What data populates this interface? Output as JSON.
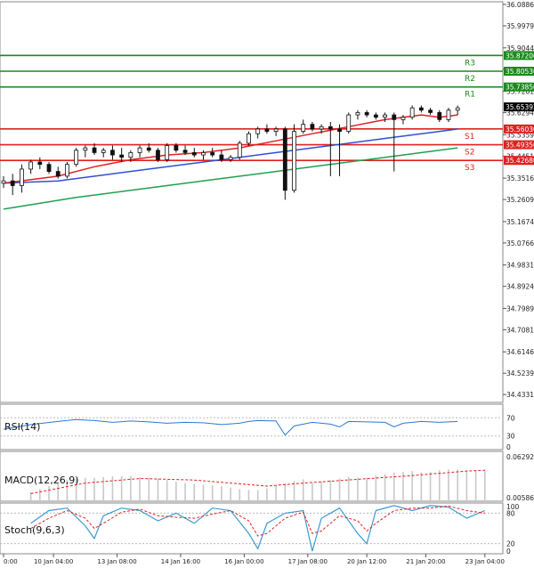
{
  "chart_data": {
    "type": "candlestick",
    "instrument": "",
    "main": {
      "ylim": [
        34.4,
        36.1
      ],
      "y_ticks": [
        "36.08865",
        "35.99790",
        "35.90440",
        "35.81365",
        "35.72015",
        "35.62940",
        "35.53590",
        "35.44515",
        "35.35165",
        "35.26090",
        "35.16740",
        "35.07665",
        "34.98315",
        "34.89240",
        "34.79890",
        "34.70815",
        "34.61465",
        "34.52390",
        "34.43315"
      ],
      "current_price": "35.65392",
      "levels": [
        {
          "label": "R3",
          "value": 35.872,
          "value_text": "35.87200",
          "color": "#1a8a1a"
        },
        {
          "label": "R2",
          "value": 35.8053,
          "value_text": "35.80530",
          "color": "#1a8a1a"
        },
        {
          "label": "R1",
          "value": 35.7385,
          "value_text": "35.73850",
          "color": "#1a8a1a"
        },
        {
          "label": "S1",
          "value": 35.5603,
          "value_text": "35.56030",
          "color": "#e02020"
        },
        {
          "label": "S2",
          "value": 35.4935,
          "value_text": "35.49350",
          "color": "#e02020"
        },
        {
          "label": "S3",
          "value": 35.4268,
          "value_text": "35.42680",
          "color": "#e02020"
        }
      ],
      "candles": [
        {
          "t": 0,
          "o": 35.33,
          "h": 35.36,
          "l": 35.31,
          "c": 35.34
        },
        {
          "t": 1,
          "o": 35.34,
          "h": 35.37,
          "l": 35.28,
          "c": 35.32
        },
        {
          "t": 2,
          "o": 35.32,
          "h": 35.41,
          "l": 35.29,
          "c": 35.39
        },
        {
          "t": 3,
          "o": 35.39,
          "h": 35.43,
          "l": 35.37,
          "c": 35.42
        },
        {
          "t": 4,
          "o": 35.42,
          "h": 35.44,
          "l": 35.39,
          "c": 35.41
        },
        {
          "t": 5,
          "o": 35.41,
          "h": 35.42,
          "l": 35.37,
          "c": 35.38
        },
        {
          "t": 6,
          "o": 35.38,
          "h": 35.4,
          "l": 35.35,
          "c": 35.36
        },
        {
          "t": 7,
          "o": 35.36,
          "h": 35.42,
          "l": 35.35,
          "c": 35.41
        },
        {
          "t": 8,
          "o": 35.41,
          "h": 35.48,
          "l": 35.4,
          "c": 35.47
        },
        {
          "t": 9,
          "o": 35.47,
          "h": 35.49,
          "l": 35.44,
          "c": 35.48
        },
        {
          "t": 10,
          "o": 35.48,
          "h": 35.5,
          "l": 35.45,
          "c": 35.46
        },
        {
          "t": 11,
          "o": 35.46,
          "h": 35.48,
          "l": 35.44,
          "c": 35.47
        },
        {
          "t": 12,
          "o": 35.47,
          "h": 35.49,
          "l": 35.43,
          "c": 35.45
        },
        {
          "t": 13,
          "o": 35.45,
          "h": 35.48,
          "l": 35.42,
          "c": 35.44
        },
        {
          "t": 14,
          "o": 35.44,
          "h": 35.47,
          "l": 35.42,
          "c": 35.46
        },
        {
          "t": 15,
          "o": 35.46,
          "h": 35.49,
          "l": 35.44,
          "c": 35.48
        },
        {
          "t": 16,
          "o": 35.48,
          "h": 35.5,
          "l": 35.46,
          "c": 35.47
        },
        {
          "t": 17,
          "o": 35.47,
          "h": 35.48,
          "l": 35.42,
          "c": 35.43
        },
        {
          "t": 18,
          "o": 35.43,
          "h": 35.5,
          "l": 35.42,
          "c": 35.49
        },
        {
          "t": 19,
          "o": 35.49,
          "h": 35.5,
          "l": 35.46,
          "c": 35.47
        },
        {
          "t": 20,
          "o": 35.47,
          "h": 35.49,
          "l": 35.45,
          "c": 35.46
        },
        {
          "t": 21,
          "o": 35.46,
          "h": 35.48,
          "l": 35.44,
          "c": 35.45
        },
        {
          "t": 22,
          "o": 35.45,
          "h": 35.47,
          "l": 35.43,
          "c": 35.46
        },
        {
          "t": 23,
          "o": 35.46,
          "h": 35.48,
          "l": 35.44,
          "c": 35.45
        },
        {
          "t": 24,
          "o": 35.45,
          "h": 35.47,
          "l": 35.42,
          "c": 35.43
        },
        {
          "t": 25,
          "o": 35.43,
          "h": 35.45,
          "l": 35.42,
          "c": 35.44
        },
        {
          "t": 26,
          "o": 35.44,
          "h": 35.51,
          "l": 35.43,
          "c": 35.5
        },
        {
          "t": 27,
          "o": 35.5,
          "h": 35.55,
          "l": 35.49,
          "c": 35.54
        },
        {
          "t": 28,
          "o": 35.54,
          "h": 35.57,
          "l": 35.52,
          "c": 35.56
        },
        {
          "t": 29,
          "o": 35.56,
          "h": 35.58,
          "l": 35.54,
          "c": 35.55
        },
        {
          "t": 30,
          "o": 35.55,
          "h": 35.57,
          "l": 35.53,
          "c": 35.56
        },
        {
          "t": 31,
          "o": 35.56,
          "h": 35.57,
          "l": 35.26,
          "c": 35.3
        },
        {
          "t": 32,
          "o": 35.3,
          "h": 35.58,
          "l": 35.29,
          "c": 35.55
        },
        {
          "t": 33,
          "o": 35.55,
          "h": 35.6,
          "l": 35.54,
          "c": 35.58
        },
        {
          "t": 34,
          "o": 35.58,
          "h": 35.59,
          "l": 35.55,
          "c": 35.56
        },
        {
          "t": 35,
          "o": 35.56,
          "h": 35.58,
          "l": 35.54,
          "c": 35.57
        },
        {
          "t": 36,
          "o": 35.57,
          "h": 35.59,
          "l": 35.36,
          "c": 35.56
        },
        {
          "t": 37,
          "o": 35.56,
          "h": 35.58,
          "l": 35.36,
          "c": 35.55
        },
        {
          "t": 38,
          "o": 35.55,
          "h": 35.63,
          "l": 35.54,
          "c": 35.62
        },
        {
          "t": 39,
          "o": 35.62,
          "h": 35.64,
          "l": 35.6,
          "c": 35.63
        },
        {
          "t": 40,
          "o": 35.63,
          "h": 35.64,
          "l": 35.61,
          "c": 35.62
        },
        {
          "t": 41,
          "o": 35.62,
          "h": 35.63,
          "l": 35.6,
          "c": 35.61
        },
        {
          "t": 42,
          "o": 35.61,
          "h": 35.63,
          "l": 35.59,
          "c": 35.62
        },
        {
          "t": 43,
          "o": 35.62,
          "h": 35.63,
          "l": 35.38,
          "c": 35.6
        },
        {
          "t": 44,
          "o": 35.6,
          "h": 35.62,
          "l": 35.58,
          "c": 35.61
        },
        {
          "t": 45,
          "o": 35.61,
          "h": 35.66,
          "l": 35.6,
          "c": 35.65
        },
        {
          "t": 46,
          "o": 35.65,
          "h": 35.66,
          "l": 35.63,
          "c": 35.64
        },
        {
          "t": 47,
          "o": 35.64,
          "h": 35.65,
          "l": 35.62,
          "c": 35.63
        },
        {
          "t": 48,
          "o": 35.63,
          "h": 35.64,
          "l": 35.59,
          "c": 35.6
        },
        {
          "t": 49,
          "o": 35.6,
          "h": 35.65,
          "l": 35.59,
          "c": 35.64
        },
        {
          "t": 50,
          "o": 35.64,
          "h": 35.66,
          "l": 35.62,
          "c": 35.65
        }
      ],
      "ma_fast": {
        "color": "#e02020",
        "values": [
          [
            0,
            35.33
          ],
          [
            6,
            35.36
          ],
          [
            10,
            35.4
          ],
          [
            14,
            35.43
          ],
          [
            18,
            35.45
          ],
          [
            22,
            35.46
          ],
          [
            26,
            35.48
          ],
          [
            30,
            35.51
          ],
          [
            34,
            35.54
          ],
          [
            38,
            35.57
          ],
          [
            42,
            35.6
          ],
          [
            46,
            35.62
          ],
          [
            48,
            35.61
          ],
          [
            50,
            35.62
          ]
        ]
      },
      "ma_mid": {
        "color": "#3050d0",
        "values": [
          [
            0,
            35.33
          ],
          [
            6,
            35.34
          ],
          [
            12,
            35.37
          ],
          [
            18,
            35.4
          ],
          [
            24,
            35.43
          ],
          [
            30,
            35.46
          ],
          [
            36,
            35.49
          ],
          [
            42,
            35.52
          ],
          [
            48,
            35.55
          ],
          [
            50,
            35.56
          ]
        ]
      },
      "ma_slow": {
        "color": "#20a050",
        "values": [
          [
            0,
            35.22
          ],
          [
            8,
            35.27
          ],
          [
            16,
            35.31
          ],
          [
            24,
            35.35
          ],
          [
            30,
            35.38
          ],
          [
            36,
            35.41
          ],
          [
            42,
            35.44
          ],
          [
            48,
            35.47
          ],
          [
            50,
            35.48
          ]
        ]
      }
    },
    "x_labels": [
      {
        "pos": 0,
        "text": "0:00"
      },
      {
        "pos": 5.5,
        "text": "10 Jan 04:00"
      },
      {
        "pos": 12.5,
        "text": "13 Jan 08:00"
      },
      {
        "pos": 19.5,
        "text": "14 Jan 16:00"
      },
      {
        "pos": 26.5,
        "text": "16 Jan 00:00"
      },
      {
        "pos": 33.5,
        "text": "17 Jan 08:00"
      },
      {
        "pos": 40,
        "text": "20 Jan 12:00"
      },
      {
        "pos": 46.5,
        "text": "21 Jan 20:00"
      },
      {
        "pos": 53,
        "text": "23 Jan 04:00"
      }
    ],
    "rsi": {
      "label": "RSI(14)",
      "ylim": [
        0,
        100
      ],
      "ticks": [
        "70",
        "30",
        "0"
      ],
      "levels": [
        70,
        30
      ],
      "color": "#2a78d8",
      "values": [
        [
          0,
          45
        ],
        [
          3,
          55
        ],
        [
          6,
          62
        ],
        [
          8,
          66
        ],
        [
          10,
          64
        ],
        [
          12,
          60
        ],
        [
          14,
          63
        ],
        [
          16,
          61
        ],
        [
          18,
          58
        ],
        [
          20,
          60
        ],
        [
          22,
          59
        ],
        [
          24,
          55
        ],
        [
          26,
          58
        ],
        [
          27,
          62
        ],
        [
          28,
          64
        ],
        [
          30,
          63
        ],
        [
          31,
          32
        ],
        [
          32,
          52
        ],
        [
          34,
          60
        ],
        [
          36,
          56
        ],
        [
          37,
          50
        ],
        [
          38,
          62
        ],
        [
          40,
          61
        ],
        [
          42,
          60
        ],
        [
          43,
          50
        ],
        [
          44,
          58
        ],
        [
          46,
          62
        ],
        [
          48,
          60
        ],
        [
          50,
          62
        ]
      ]
    },
    "macd": {
      "label": "MACD(12,26,9)",
      "ticks": [
        "0.062928",
        "0.005862"
      ],
      "hist_color": "#c8c8c8",
      "signal_color": "#e02020",
      "hist": [
        0.012,
        0.016,
        0.02,
        0.024,
        0.028,
        0.03,
        0.031,
        0.031,
        0.032,
        0.033,
        0.033,
        0.033,
        0.032,
        0.031,
        0.03,
        0.028,
        0.026,
        0.024,
        0.023,
        0.022,
        0.021,
        0.02,
        0.018,
        0.016,
        0.015,
        0.015,
        0.017,
        0.02,
        0.024,
        0.027,
        0.029,
        0.024,
        0.026,
        0.028,
        0.03,
        0.032,
        0.031,
        0.031,
        0.034,
        0.036,
        0.038,
        0.039,
        0.04,
        0.038,
        0.039,
        0.041,
        0.042,
        0.042,
        0.041,
        0.041,
        0.042
      ],
      "signal": [
        [
          0,
          0.01
        ],
        [
          6,
          0.024
        ],
        [
          12,
          0.03
        ],
        [
          18,
          0.028
        ],
        [
          22,
          0.024
        ],
        [
          26,
          0.02
        ],
        [
          30,
          0.024
        ],
        [
          36,
          0.029
        ],
        [
          42,
          0.034
        ],
        [
          48,
          0.04
        ],
        [
          50,
          0.041
        ]
      ]
    },
    "stoch": {
      "label": "Stoch(9,6,3)",
      "ticks": [
        "100",
        "80",
        "20",
        "0"
      ],
      "levels": [
        80,
        20
      ],
      "k_color": "#3a9ad0",
      "d_color": "#e02020",
      "k": [
        [
          0,
          60
        ],
        [
          2,
          85
        ],
        [
          4,
          90
        ],
        [
          6,
          55
        ],
        [
          7,
          30
        ],
        [
          8,
          75
        ],
        [
          10,
          90
        ],
        [
          12,
          85
        ],
        [
          14,
          65
        ],
        [
          16,
          80
        ],
        [
          18,
          60
        ],
        [
          20,
          90
        ],
        [
          22,
          85
        ],
        [
          24,
          40
        ],
        [
          25,
          10
        ],
        [
          26,
          60
        ],
        [
          28,
          80
        ],
        [
          30,
          85
        ],
        [
          31,
          5
        ],
        [
          32,
          70
        ],
        [
          34,
          90
        ],
        [
          36,
          40
        ],
        [
          37,
          20
        ],
        [
          38,
          85
        ],
        [
          40,
          95
        ],
        [
          42,
          85
        ],
        [
          44,
          95
        ],
        [
          46,
          92
        ],
        [
          48,
          70
        ],
        [
          50,
          85
        ]
      ],
      "d": [
        [
          0,
          50
        ],
        [
          2,
          70
        ],
        [
          4,
          85
        ],
        [
          6,
          70
        ],
        [
          7,
          50
        ],
        [
          8,
          60
        ],
        [
          10,
          82
        ],
        [
          12,
          88
        ],
        [
          14,
          75
        ],
        [
          16,
          72
        ],
        [
          18,
          70
        ],
        [
          20,
          78
        ],
        [
          22,
          85
        ],
        [
          24,
          65
        ],
        [
          25,
          35
        ],
        [
          26,
          40
        ],
        [
          28,
          70
        ],
        [
          30,
          82
        ],
        [
          31,
          40
        ],
        [
          32,
          45
        ],
        [
          34,
          75
        ],
        [
          36,
          65
        ],
        [
          37,
          45
        ],
        [
          38,
          60
        ],
        [
          40,
          85
        ],
        [
          42,
          90
        ],
        [
          44,
          90
        ],
        [
          46,
          94
        ],
        [
          48,
          85
        ],
        [
          50,
          80
        ]
      ]
    }
  }
}
